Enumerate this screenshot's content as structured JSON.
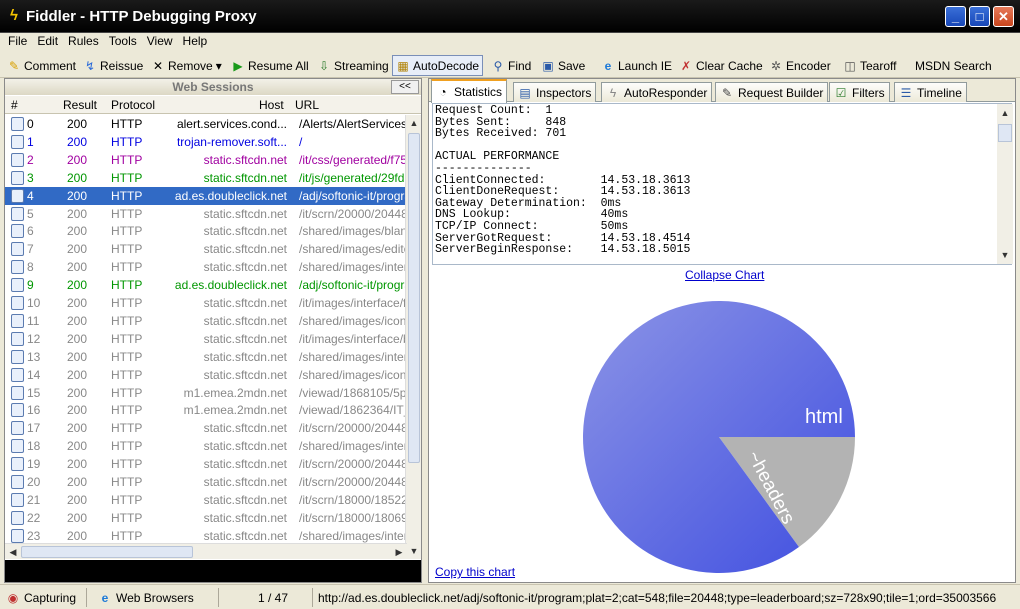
{
  "window": {
    "title": "Fiddler - HTTP Debugging Proxy",
    "minimize": "_",
    "maximize": "□",
    "close": "✕"
  },
  "menu": [
    "File",
    "Edit",
    "Rules",
    "Tools",
    "View",
    "Help"
  ],
  "toolbar": {
    "comment": "Comment",
    "reissue": "Reissue",
    "remove": "Remove",
    "remove_arrow": "▾",
    "resume_all": "Resume All",
    "streaming": "Streaming",
    "autodecode": "AutoDecode",
    "find": "Find",
    "save": "Save",
    "launch_ie": "Launch IE",
    "clear_cache": "Clear Cache",
    "encoder": "Encoder",
    "tearoff": "Tearoff",
    "msdn_search": "MSDN Search"
  },
  "sessions": {
    "header": "Web Sessions",
    "collapse": "<<",
    "columns": {
      "num": "#",
      "result": "Result",
      "protocol": "Protocol",
      "host": "Host",
      "url": "URL"
    },
    "rows": [
      {
        "num": "0",
        "result": "200",
        "protocol": "HTTP",
        "host": "alert.services.cond...",
        "url": "/Alerts/AlertServices.",
        "style": "black"
      },
      {
        "num": "1",
        "result": "200",
        "protocol": "HTTP",
        "host": "trojan-remover.soft...",
        "url": "/",
        "style": "blue"
      },
      {
        "num": "2",
        "result": "200",
        "protocol": "HTTP",
        "host": "static.sftcdn.net",
        "url": "/it/css/generated/f75",
        "style": "purple"
      },
      {
        "num": "3",
        "result": "200",
        "protocol": "HTTP",
        "host": "static.sftcdn.net",
        "url": "/it/js/generated/29fd",
        "style": "green"
      },
      {
        "num": "4",
        "result": "200",
        "protocol": "HTTP",
        "host": "ad.es.doubleclick.net",
        "url": "/adj/softonic-it/progra",
        "style": "sel"
      },
      {
        "num": "5",
        "result": "200",
        "protocol": "HTTP",
        "host": "static.sftcdn.net",
        "url": "/it/scrn/20000/20448,",
        "style": "gray"
      },
      {
        "num": "6",
        "result": "200",
        "protocol": "HTTP",
        "host": "static.sftcdn.net",
        "url": "/shared/images/blank",
        "style": "gray"
      },
      {
        "num": "7",
        "result": "200",
        "protocol": "HTTP",
        "host": "static.sftcdn.net",
        "url": "/shared/images/editor",
        "style": "gray"
      },
      {
        "num": "8",
        "result": "200",
        "protocol": "HTTP",
        "host": "static.sftcdn.net",
        "url": "/shared/images/interf",
        "style": "gray"
      },
      {
        "num": "9",
        "result": "200",
        "protocol": "HTTP",
        "host": "ad.es.doubleclick.net",
        "url": "/adj/softonic-it/progra",
        "style": "green"
      },
      {
        "num": "10",
        "result": "200",
        "protocol": "HTTP",
        "host": "static.sftcdn.net",
        "url": "/it/images/interface/fi",
        "style": "gray"
      },
      {
        "num": "11",
        "result": "200",
        "protocol": "HTTP",
        "host": "static.sftcdn.net",
        "url": "/shared/images/icons,",
        "style": "gray"
      },
      {
        "num": "12",
        "result": "200",
        "protocol": "HTTP",
        "host": "static.sftcdn.net",
        "url": "/it/images/interface/b",
        "style": "gray"
      },
      {
        "num": "13",
        "result": "200",
        "protocol": "HTTP",
        "host": "static.sftcdn.net",
        "url": "/shared/images/interf",
        "style": "gray"
      },
      {
        "num": "14",
        "result": "200",
        "protocol": "HTTP",
        "host": "static.sftcdn.net",
        "url": "/shared/images/icons,",
        "style": "gray"
      },
      {
        "num": "15",
        "result": "200",
        "protocol": "HTTP",
        "host": "m1.emea.2mdn.net",
        "url": "/viewad/1868105/5py",
        "style": "gray"
      },
      {
        "num": "16",
        "result": "200",
        "protocol": "HTTP",
        "host": "m1.emea.2mdn.net",
        "url": "/viewad/1862364/IT_",
        "style": "gray"
      },
      {
        "num": "17",
        "result": "200",
        "protocol": "HTTP",
        "host": "static.sftcdn.net",
        "url": "/it/scrn/20000/20448,",
        "style": "gray"
      },
      {
        "num": "18",
        "result": "200",
        "protocol": "HTTP",
        "host": "static.sftcdn.net",
        "url": "/shared/images/interf",
        "style": "gray"
      },
      {
        "num": "19",
        "result": "200",
        "protocol": "HTTP",
        "host": "static.sftcdn.net",
        "url": "/it/scrn/20000/20448,",
        "style": "gray"
      },
      {
        "num": "20",
        "result": "200",
        "protocol": "HTTP",
        "host": "static.sftcdn.net",
        "url": "/it/scrn/20000/20448,",
        "style": "gray"
      },
      {
        "num": "21",
        "result": "200",
        "protocol": "HTTP",
        "host": "static.sftcdn.net",
        "url": "/it/scrn/18000/18522,",
        "style": "gray"
      },
      {
        "num": "22",
        "result": "200",
        "protocol": "HTTP",
        "host": "static.sftcdn.net",
        "url": "/it/scrn/18000/18069,",
        "style": "gray"
      },
      {
        "num": "23",
        "result": "200",
        "protocol": "HTTP",
        "host": "static.sftcdn.net",
        "url": "/shared/images/interf",
        "style": "gray"
      }
    ]
  },
  "tabs": [
    "Statistics",
    "Inspectors",
    "AutoResponder",
    "Request Builder",
    "Filters",
    "Timeline"
  ],
  "statistics_text": "Request Count:  1\nBytes Sent:     848\nBytes Received: 701\n\nACTUAL PERFORMANCE\n--------------\nClientConnected:        14.53.18.3613\nClientDoneRequest:      14.53.18.3613\nGateway Determination:  0ms\nDNS Lookup:             40ms\nTCP/IP Connect:         50ms\nServerGotRequest:       14.53.18.4514\nServerBeginResponse:    14.53.18.5015",
  "collapse_chart": "Collapse Chart",
  "copy_chart": "Copy this chart",
  "chart_data": {
    "type": "pie",
    "labels": [
      "html",
      "~headers"
    ],
    "values": [
      85,
      15
    ],
    "colors": [
      "#6d77e6",
      "#b3b3b3"
    ]
  },
  "status": {
    "capturing": "Capturing",
    "web_browsers": "Web Browsers",
    "count": "1 / 47",
    "url": "http://ad.es.doubleclick.net/adj/softonic-it/program;plat=2;cat=548;file=20448;type=leaderboard;sz=728x90;tile=1;ord=35003566"
  }
}
